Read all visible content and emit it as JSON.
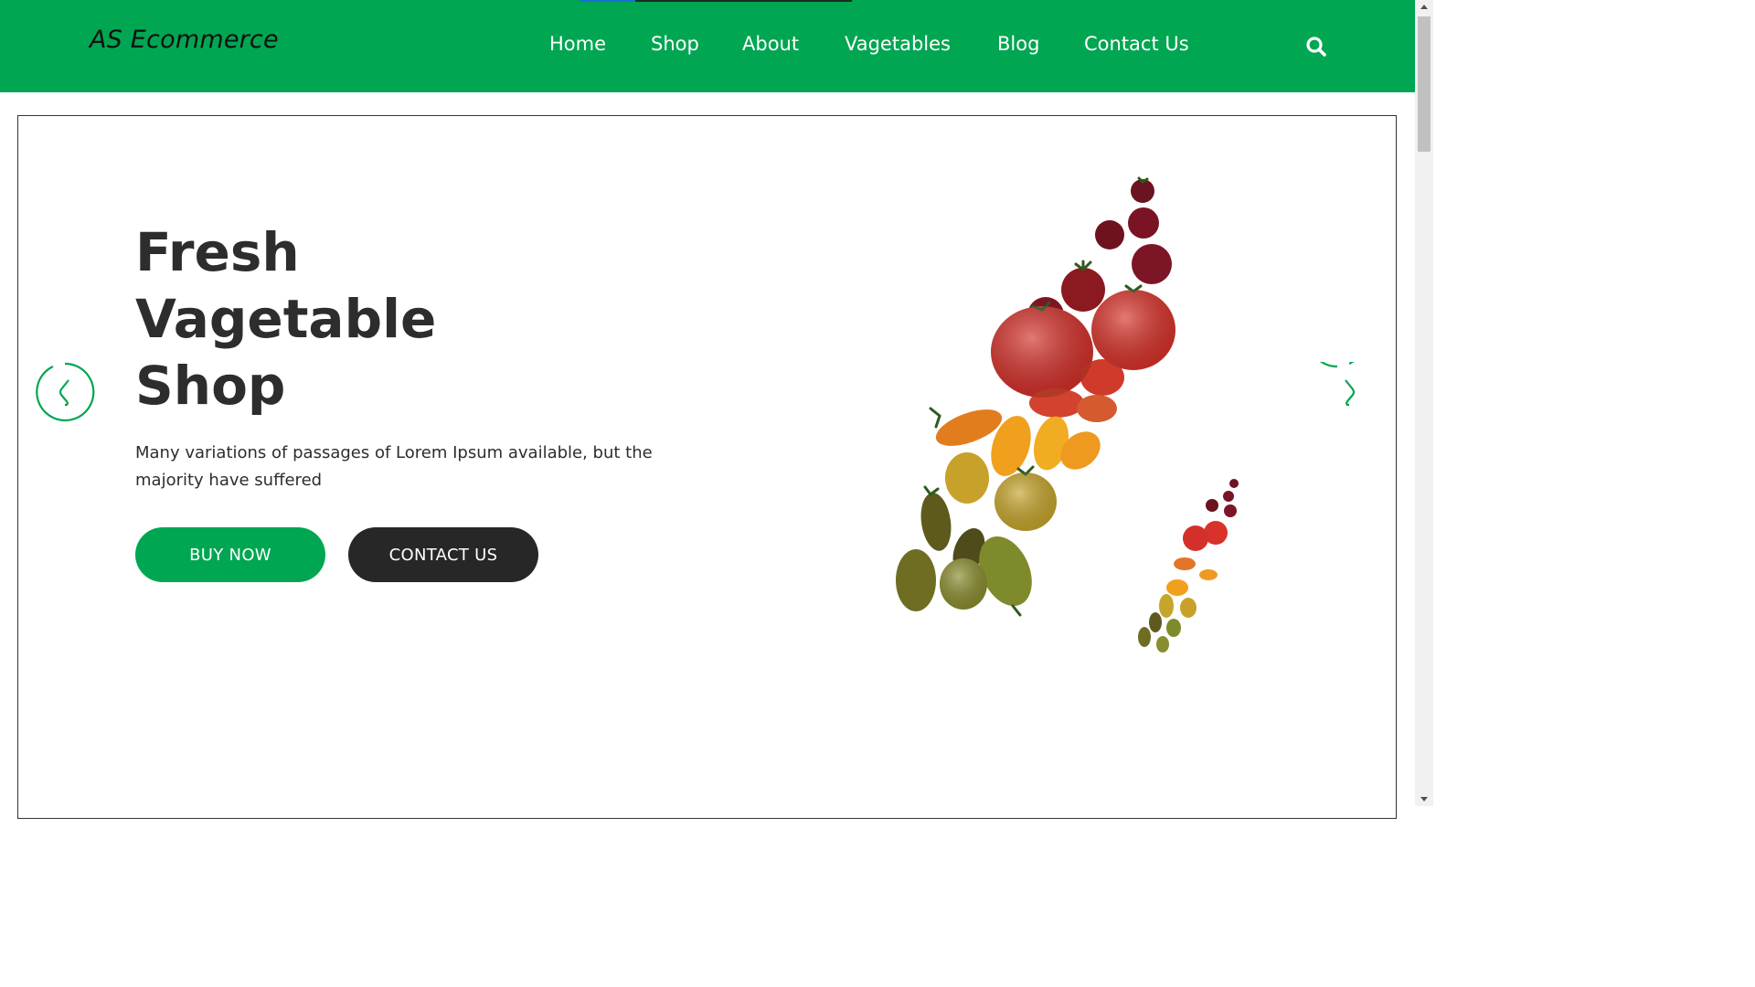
{
  "header": {
    "logo": "AS Ecommerce",
    "nav": [
      {
        "label": "Home"
      },
      {
        "label": "Shop"
      },
      {
        "label": "About"
      },
      {
        "label": "Vagetables"
      },
      {
        "label": "Blog"
      },
      {
        "label": "Contact Us"
      }
    ],
    "search_icon": "search-icon"
  },
  "hero": {
    "title_lines": [
      "Fresh",
      "Vagetable",
      "Shop"
    ],
    "description": "Many variations of passages of Lorem Ipsum available, but the majority have suffered",
    "buy_button": "BUY NOW",
    "contact_button": "CONTACT US",
    "prev_icon": "arrow-left-circle-icon",
    "next_icon": "arrow-right-circle-icon",
    "image": "heirloom-tomatoes-image"
  },
  "colors": {
    "brand_green": "#00a651",
    "dark": "#272727",
    "text": "#2d2d2d"
  }
}
